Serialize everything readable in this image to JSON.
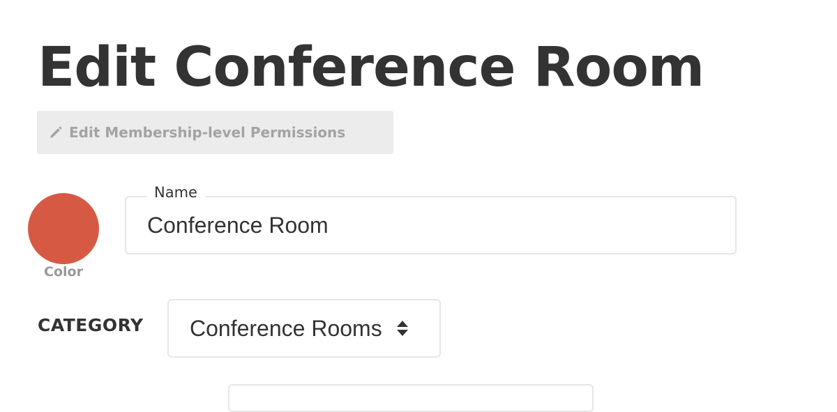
{
  "page": {
    "title": "Edit Conference Room"
  },
  "permissions_button": {
    "label": "Edit Membership-level Permissions",
    "icon": "pencil-icon"
  },
  "color_picker": {
    "label": "Color",
    "value": "#d65a43"
  },
  "name_field": {
    "label": "Name",
    "value": "Conference Room"
  },
  "category": {
    "label": "CATEGORY",
    "selected": "Conference Rooms",
    "icon": "sort-icon"
  },
  "colors": {
    "title": "#333333",
    "button_bg": "#ececec",
    "button_text": "#a3a3a3",
    "border": "#e6e6e6",
    "swatch": "#d65a43"
  }
}
